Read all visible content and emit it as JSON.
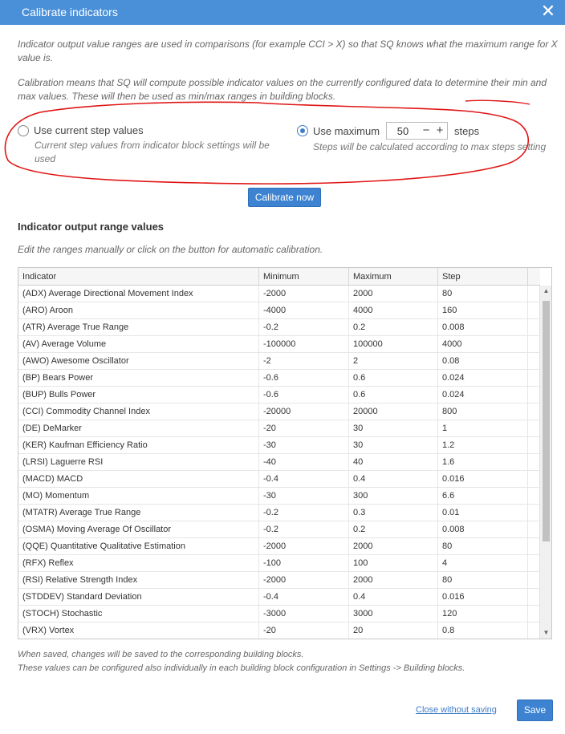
{
  "window": {
    "title": "Calibrate indicators"
  },
  "intro": {
    "line1": "Indicator output value ranges are used in comparisons (for example CCI > X) so that SQ knows what the maximum range for X",
    "line2": "value is.",
    "line3": "Calibration means that SQ will compute possible indicator values on the currently configured data to determine their min and",
    "line4": "max values. These will then be used as min/max ranges in building blocks."
  },
  "options": {
    "current": {
      "label": "Use current step values",
      "desc1": "Current step values from indicator block settings will be",
      "desc2": "used",
      "selected": false
    },
    "maximum": {
      "label": "Use maximum",
      "value": "50",
      "steps_label": "steps",
      "desc": "Steps will be calculated according to max steps setting",
      "selected": true
    }
  },
  "calibrate_button": "Calibrate now",
  "section": {
    "title": "Indicator output range values",
    "hint": "Edit the ranges manually or click on the button for automatic calibration."
  },
  "table": {
    "headers": [
      "Indicator",
      "Minimum",
      "Maximum",
      "Step"
    ],
    "rows": [
      [
        "(ADX) Average Directional Movement Index",
        "-2000",
        "2000",
        "80"
      ],
      [
        "(ARO) Aroon",
        "-4000",
        "4000",
        "160"
      ],
      [
        "(ATR) Average True Range",
        "-0.2",
        "0.2",
        "0.008"
      ],
      [
        "(AV) Average Volume",
        "-100000",
        "100000",
        "4000"
      ],
      [
        "(AWO) Awesome Oscillator",
        "-2",
        "2",
        "0.08"
      ],
      [
        "(BP) Bears Power",
        "-0.6",
        "0.6",
        "0.024"
      ],
      [
        "(BUP) Bulls Power",
        "-0.6",
        "0.6",
        "0.024"
      ],
      [
        "(CCI) Commodity Channel Index",
        "-20000",
        "20000",
        "800"
      ],
      [
        "(DE) DeMarker",
        "-20",
        "30",
        "1"
      ],
      [
        "(KER) Kaufman Efficiency Ratio",
        "-30",
        "30",
        "1.2"
      ],
      [
        "(LRSI) Laguerre RSI",
        "-40",
        "40",
        "1.6"
      ],
      [
        "(MACD) MACD",
        "-0.4",
        "0.4",
        "0.016"
      ],
      [
        "(MO) Momentum",
        "-30",
        "300",
        "6.6"
      ],
      [
        "(MTATR) Average True Range",
        "-0.2",
        "0.3",
        "0.01"
      ],
      [
        "(OSMA) Moving Average Of Oscillator",
        "-0.2",
        "0.2",
        "0.008"
      ],
      [
        "(QQE) Quantitative Qualitative Estimation",
        "-2000",
        "2000",
        "80"
      ],
      [
        "(RFX) Reflex",
        "-100",
        "100",
        "4"
      ],
      [
        "(RSI) Relative Strength Index",
        "-2000",
        "2000",
        "80"
      ],
      [
        "(STDDEV) Standard Deviation",
        "-0.4",
        "0.4",
        "0.016"
      ],
      [
        "(STOCH) Stochastic",
        "-3000",
        "3000",
        "120"
      ],
      [
        "(VRX) Vortex",
        "-20",
        "20",
        "0.8"
      ]
    ]
  },
  "footer": {
    "note1": "When saved, changes will be saved to the corresponding building blocks.",
    "note2": "These values can be configured also individually in each building block configuration in Settings -> Building blocks.",
    "close_link": "Close without saving",
    "save_button": "Save"
  },
  "annotation": {
    "color": "#e01515"
  }
}
